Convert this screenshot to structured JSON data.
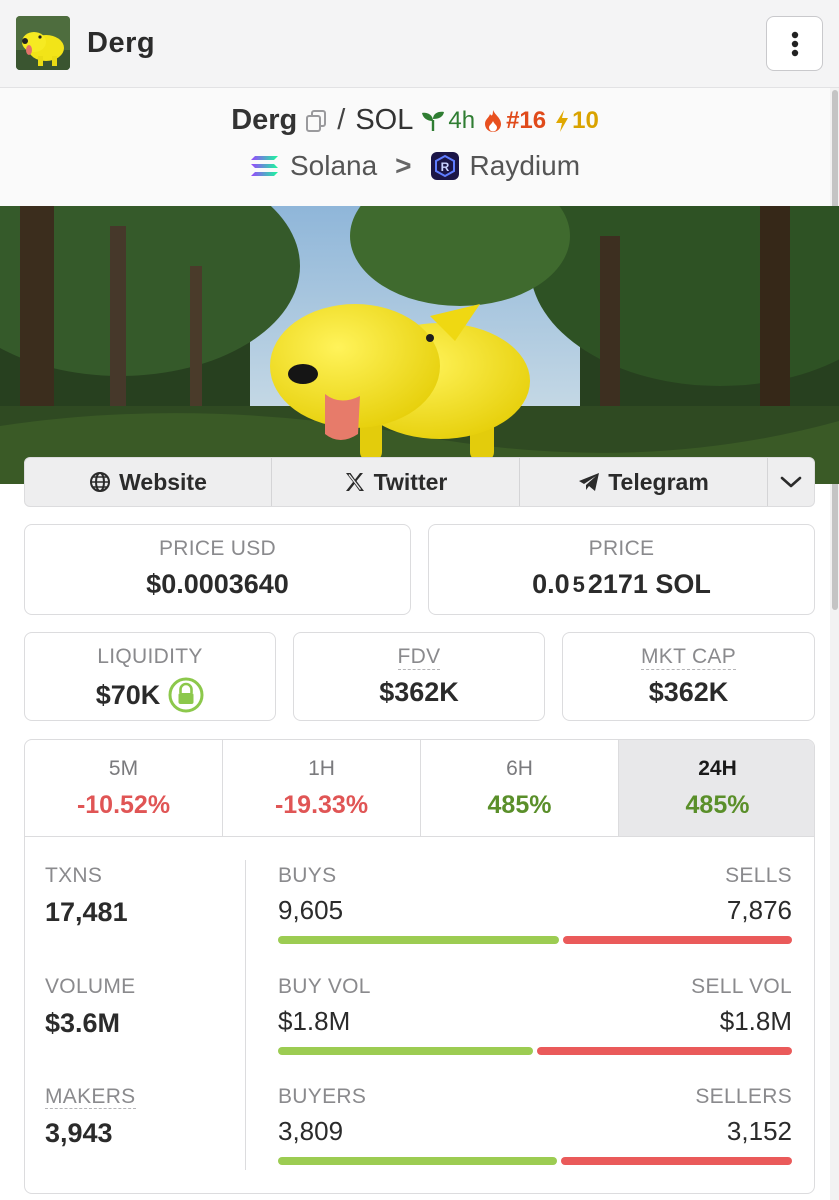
{
  "header": {
    "title": "Derg",
    "menu_icon": "kebab-menu-icon"
  },
  "pair": {
    "base": "Derg",
    "separator": "/",
    "quote": "SOL",
    "age": "4h",
    "rank": "#16",
    "boosts": "10",
    "chain": "Solana",
    "chevron": ">",
    "dex": "Raydium"
  },
  "links": {
    "website": "Website",
    "twitter": "Twitter",
    "telegram": "Telegram"
  },
  "prices": {
    "price_usd_label": "PRICE USD",
    "price_usd": "$0.0003640",
    "price_label": "PRICE",
    "price_native_prefix": "0.0",
    "price_native_zeros": "5",
    "price_native_digits": "2171 SOL"
  },
  "metrics": {
    "liquidity_label": "LIQUIDITY",
    "liquidity": "$70K",
    "fdv_label": "FDV",
    "fdv": "$362K",
    "mcap_label": "MKT CAP",
    "mcap": "$362K"
  },
  "timeframes": [
    {
      "label": "5M",
      "change": "-10.52%",
      "trend": "neg"
    },
    {
      "label": "1H",
      "change": "-19.33%",
      "trend": "neg"
    },
    {
      "label": "6H",
      "change": "485%",
      "trend": "pos"
    },
    {
      "label": "24H",
      "change": "485%",
      "trend": "pos"
    }
  ],
  "activity": {
    "txns_label": "TXNS",
    "txns": "17,481",
    "volume_label": "VOLUME",
    "volume": "$3.6M",
    "makers_label": "MAKERS",
    "makers": "3,943",
    "buys_label": "BUYS",
    "buys": "9,605",
    "sells_label": "SELLS",
    "sells": "7,876",
    "buys_fraction": 0.55,
    "buy_vol_label": "BUY VOL",
    "buy_vol": "$1.8M",
    "sell_vol_label": "SELL VOL",
    "sell_vol": "$1.8M",
    "buy_vol_fraction": 0.5,
    "buyers_label": "BUYERS",
    "buyers": "3,809",
    "sellers_label": "SELLERS",
    "sellers": "3,152",
    "buyers_fraction": 0.547
  },
  "colors": {
    "positive": "#5a8f2a",
    "negative": "#e05555",
    "bar_green": "#9ccc52",
    "bar_red": "#ea5a5a"
  }
}
